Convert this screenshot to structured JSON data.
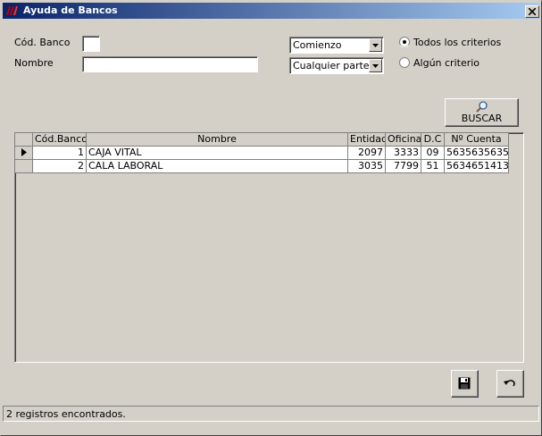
{
  "window": {
    "title": "Ayuda de Bancos",
    "close_label": "x"
  },
  "form": {
    "cod_banco_label": "Cód. Banco",
    "cod_banco_value": "",
    "nombre_label": "Nombre",
    "nombre_value": "",
    "match_mode_selected": "Comienzo",
    "match_position_selected": "Cualquier parte",
    "criteria_all_label": "Todos los criterios",
    "criteria_any_label": "Algún criterio",
    "criteria_selected": "all"
  },
  "search_button": {
    "label": "BUSCAR",
    "icon": "magnifier-icon"
  },
  "grid": {
    "columns": [
      "Cód.Banco",
      "Nombre",
      "Entidad",
      "Oficina",
      "D.C",
      "Nº Cuenta"
    ],
    "rows": [
      {
        "cod": "1",
        "nombre": "CAJA VITAL",
        "entidad": "2097",
        "oficina": "3333",
        "dc": "09",
        "cuenta": "5635635635"
      },
      {
        "cod": "2",
        "nombre": "CALA LABORAL",
        "entidad": "3035",
        "oficina": "7799",
        "dc": "51",
        "cuenta": "5634651413"
      }
    ],
    "current_row_indicator": "row-pointer-icon"
  },
  "actions": {
    "save_icon": "floppy-disk-icon",
    "undo_icon": "undo-arrow-icon"
  },
  "status": {
    "text": "2 registros encontrados."
  }
}
